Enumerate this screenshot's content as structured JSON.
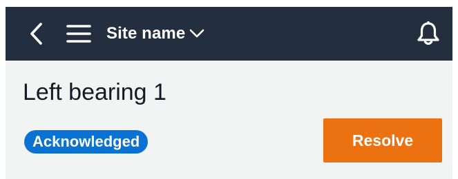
{
  "header": {
    "back_icon": "chevron-left-icon",
    "menu_icon": "hamburger-menu-icon",
    "site_selector": {
      "label": "Site name",
      "icon": "chevron-down-icon"
    },
    "notifications_icon": "bell-icon",
    "background_color": "#232f3e"
  },
  "main": {
    "title": "Left bearing 1",
    "status_badge": {
      "label": "Acknowledged",
      "color": "#0972d3"
    },
    "resolve_button": {
      "label": "Resolve",
      "color": "#ec7211"
    }
  }
}
